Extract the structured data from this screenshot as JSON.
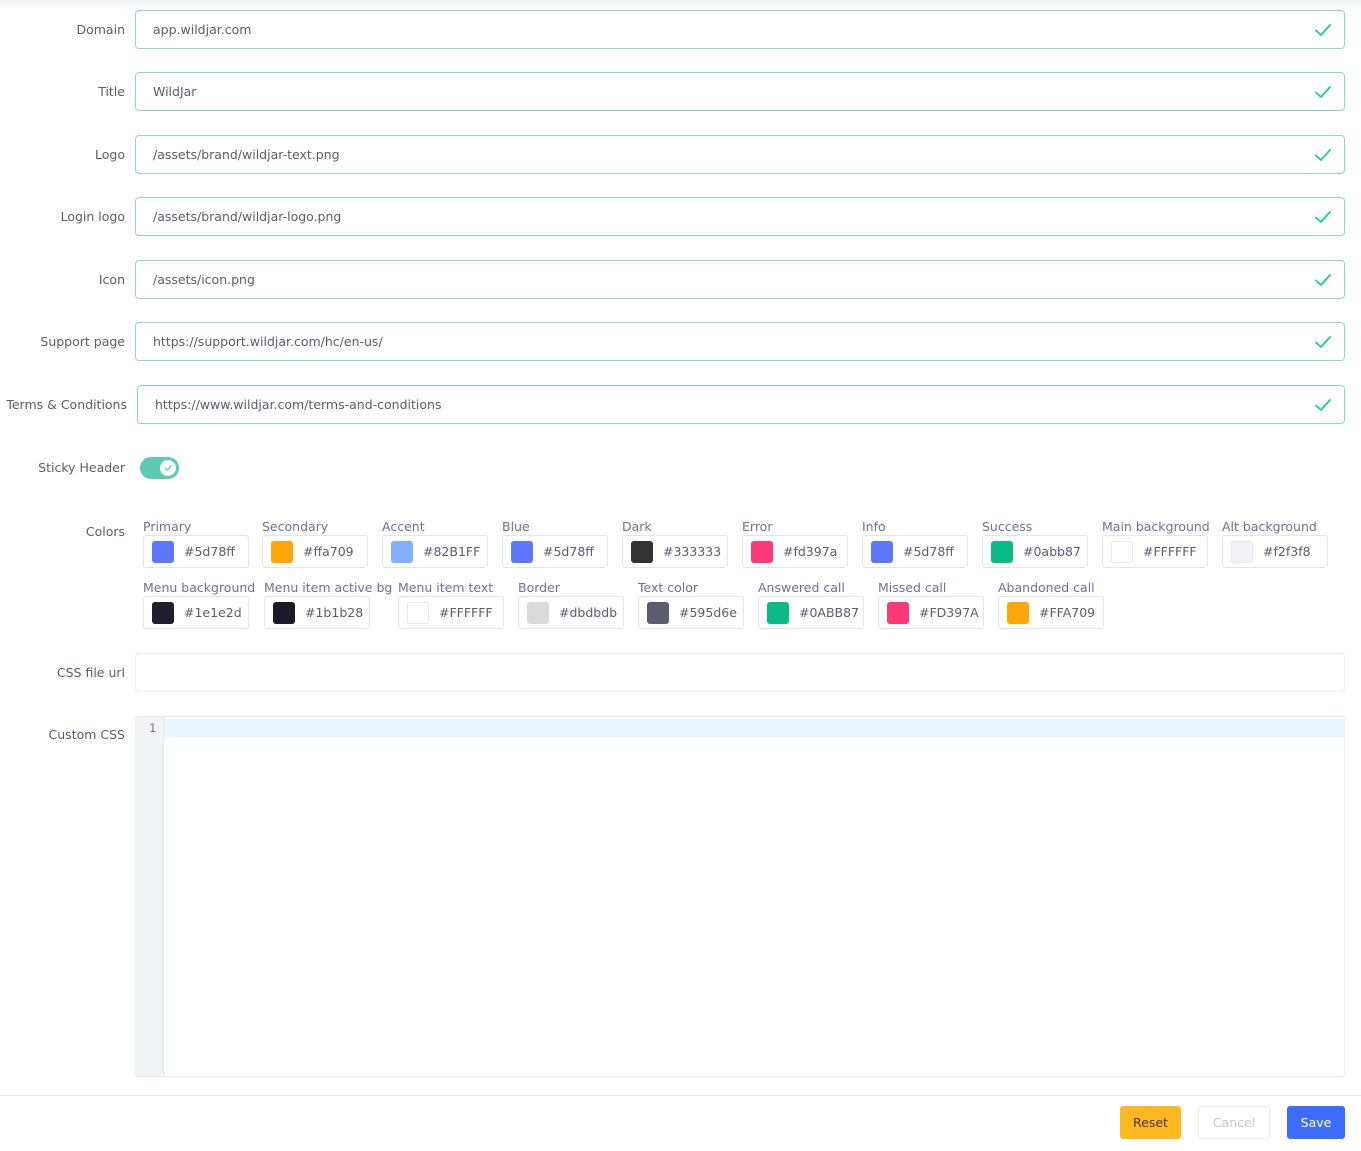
{
  "fields": [
    {
      "label": "Domain",
      "value": "app.wildjar.com"
    },
    {
      "label": "Title",
      "value": "WildJar"
    },
    {
      "label": "Logo",
      "value": "/assets/brand/wildjar-text.png"
    },
    {
      "label": "Login logo",
      "value": "/assets/brand/wildjar-logo.png"
    },
    {
      "label": "Icon",
      "value": "/assets/icon.png"
    },
    {
      "label": "Support page",
      "value": "https://support.wildjar.com/hc/en-us/"
    },
    {
      "label": "Terms & Conditions",
      "value": "https://www.wildjar.com/terms-and-conditions"
    }
  ],
  "sticky_header": {
    "label": "Sticky Header",
    "enabled": true
  },
  "colors": {
    "label": "Colors",
    "row1": [
      {
        "name": "Primary",
        "hex": "#5d78ff"
      },
      {
        "name": "Secondary",
        "hex": "#ffa709"
      },
      {
        "name": "Accent",
        "hex": "#82B1FF"
      },
      {
        "name": "Blue",
        "hex": "#5d78ff"
      },
      {
        "name": "Dark",
        "hex": "#333333"
      },
      {
        "name": "Error",
        "hex": "#fd397a"
      },
      {
        "name": "Info",
        "hex": "#5d78ff"
      },
      {
        "name": "Success",
        "hex": "#0abb87"
      },
      {
        "name": "Main background",
        "hex": "#FFFFFF"
      },
      {
        "name": "Alt background",
        "hex": "#f2f3f8"
      }
    ],
    "row2": [
      {
        "name": "Menu background",
        "hex": "#1e1e2d"
      },
      {
        "name": "Menu item active bg",
        "hex": "#1b1b28"
      },
      {
        "name": "Menu item text",
        "hex": "#FFFFFF"
      },
      {
        "name": "Border",
        "hex": "#dbdbdb"
      },
      {
        "name": "Text color",
        "hex": "#595d6e"
      },
      {
        "name": "Answered call",
        "hex": "#0ABB87"
      },
      {
        "name": "Missed call",
        "hex": "#FD397A"
      },
      {
        "name": "Abandoned call",
        "hex": "#FFA709"
      }
    ]
  },
  "css_file_url": {
    "label": "CSS file url",
    "value": ""
  },
  "custom_css": {
    "label": "Custom CSS",
    "line_number": "1"
  },
  "footer": {
    "reset_label": "Reset",
    "cancel_label": "Cancel",
    "save_label": "Save"
  }
}
